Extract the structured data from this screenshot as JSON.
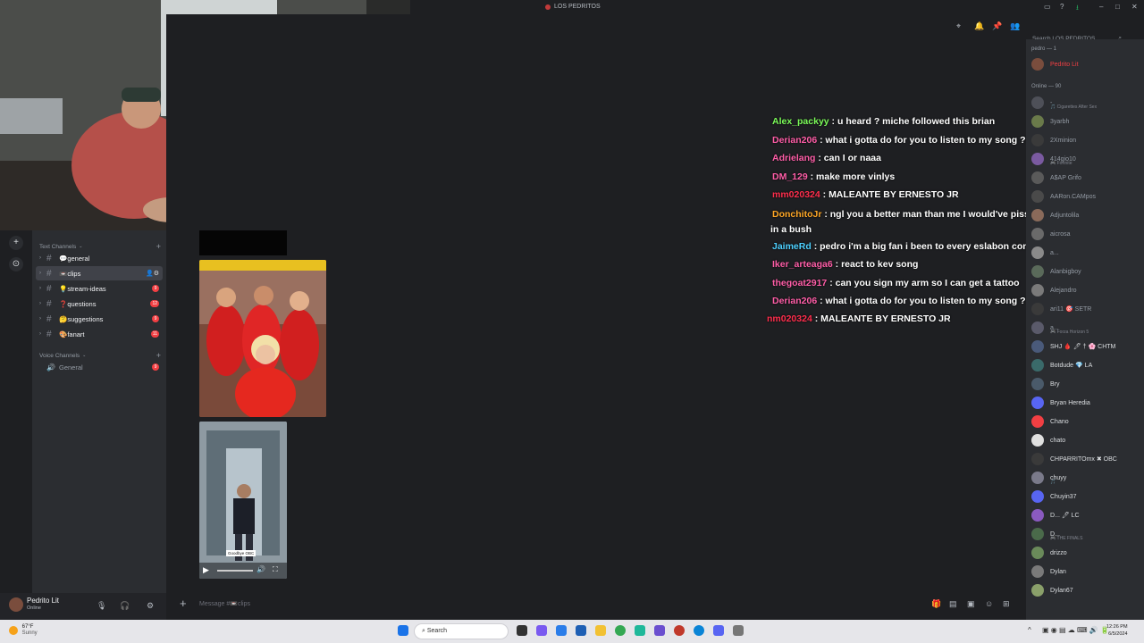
{
  "window": {
    "title": "LOS PEDRITOS"
  },
  "header": {
    "search_placeholder": "Search LOS PEDRITOS"
  },
  "sidebar": {
    "text_channels_label": "Text Channels",
    "voice_channels_label": "Voice Channels",
    "channels": [
      {
        "label": "💬general",
        "badge": ""
      },
      {
        "label": "📼clips",
        "badge": ""
      },
      {
        "label": "💡stream-ideas",
        "badge": "9"
      },
      {
        "label": "❓questions",
        "badge": "12"
      },
      {
        "label": "🤔suggestions",
        "badge": "9"
      },
      {
        "label": "🎨fanart",
        "badge": "11"
      }
    ],
    "voice": [
      {
        "label": "General",
        "badge": "9"
      }
    ]
  },
  "user_panel": {
    "name": "Pedrito Lit",
    "status": "Online"
  },
  "composer": {
    "placeholder": "Message #📼clips"
  },
  "video": {
    "caption": "Goodbye OBC"
  },
  "chat": [
    {
      "user": "Alex_packyy",
      "color": "#7cfc5a",
      "text": "u heard ? miche followed this brian"
    },
    {
      "user": "Derian206",
      "color": "#ff5ea8",
      "text": "what i gotta do for you to listen to my song ??"
    },
    {
      "user": "Adrielang",
      "color": "#ff5ea8",
      "text": "can I or naaa"
    },
    {
      "user": "DM_129",
      "color": "#ff5ea8",
      "text": "make more vinlys"
    },
    {
      "user": "mm020324",
      "color": "#ff2e4d",
      "text": "MALEANTE BY ERNESTO JR"
    },
    {
      "user": "DonchitoJr",
      "color": "#ffa726",
      "text": "ngl you a better man than me I would've pissed outside of his house in a bush"
    },
    {
      "user": "JaimeRd",
      "color": "#4dd0ff",
      "text": "pedro i'm a big fan i been to every eslabon concert in nebraska"
    },
    {
      "user": "Iker_arteaga6",
      "color": "#ff5ea8",
      "text": "react to kev song"
    },
    {
      "user": "thegoat2917",
      "color": "#ff5ea8",
      "text": "can you sign my arm so I can get a tattoo"
    },
    {
      "user": "Derian206",
      "color": "#ff5ea8",
      "text": "what i gotta do for you to listen to my song ??"
    },
    {
      "user": "nm020324",
      "color": "#ff2e4d",
      "text": "MALEANTE BY ERNESTO JR"
    }
  ],
  "members": {
    "group1_label": "pedro — 1",
    "online_label": "Online — 90",
    "list": [
      {
        "name": "Pedrito Lit",
        "sub": "",
        "color": "#f23f43",
        "av": "#7a4d3d"
      },
      {
        "name": "-",
        "sub": "🎵 Cigarettes After Sex",
        "color": "#949ba4",
        "av": "#4e5058"
      },
      {
        "name": "3yarbh",
        "sub": "",
        "color": "#949ba4",
        "av": "#6a7a4a"
      },
      {
        "name": "2Xminion",
        "sub": "",
        "color": "#949ba4",
        "av": "#3a3a3a"
      },
      {
        "name": "414gio10",
        "sub": "🎮 Fortnite",
        "color": "#949ba4",
        "av": "#7a5aa0"
      },
      {
        "name": "A$AP Grifo",
        "sub": "",
        "color": "#949ba4",
        "av": "#5a5a5a"
      },
      {
        "name": "AARon.CAMpos",
        "sub": "",
        "color": "#949ba4",
        "av": "#4a4a4a"
      },
      {
        "name": "Adjuntolila",
        "sub": "",
        "color": "#949ba4",
        "av": "#8a6a5a"
      },
      {
        "name": "aicrosa",
        "sub": "",
        "color": "#949ba4",
        "av": "#6a6a6a"
      },
      {
        "name": "a...",
        "sub": "",
        "color": "#949ba4",
        "av": "#8a8a8a"
      },
      {
        "name": "Alanbigboy",
        "sub": "",
        "color": "#949ba4",
        "av": "#5a6a5a"
      },
      {
        "name": "Alejandro",
        "sub": "",
        "color": "#949ba4",
        "av": "#7a7a7a"
      },
      {
        "name": "ari11 🎯 SETR",
        "sub": "",
        "color": "#949ba4",
        "av": "#3a3a3a"
      },
      {
        "name": "a...",
        "sub": "🎮 Forza Horizon 5",
        "color": "#949ba4",
        "av": "#5a5a6a"
      },
      {
        "name": "SHJ 🩸 🖊 † 🌸 CHTM",
        "sub": "",
        "color": "#dbdee1",
        "av": "#4a5a7a"
      },
      {
        "name": "Botdude 💎 LA",
        "sub": "",
        "color": "#dbdee1",
        "av": "#3a6a6a"
      },
      {
        "name": "Bry",
        "sub": "",
        "color": "#dbdee1",
        "av": "#4a5a6a"
      },
      {
        "name": "Bryan Heredia",
        "sub": "",
        "color": "#dbdee1",
        "av": "#5865f2"
      },
      {
        "name": "Chano",
        "sub": "",
        "color": "#dbdee1",
        "av": "#f23f43"
      },
      {
        "name": "chato",
        "sub": "",
        "color": "#dbdee1",
        "av": "#e0e0e0"
      },
      {
        "name": "CHPARRITOmx ✖ OBC",
        "sub": "",
        "color": "#dbdee1",
        "av": "#3a3a3a"
      },
      {
        "name": "chuyy",
        "sub": "🎵",
        "color": "#dbdee1",
        "av": "#7a7a8a"
      },
      {
        "name": "Chuyin37",
        "sub": "",
        "color": "#dbdee1",
        "av": "#5865f2"
      },
      {
        "name": "D... 🖊 LC",
        "sub": "",
        "color": "#dbdee1",
        "av": "#8a5ac0"
      },
      {
        "name": "D...",
        "sub": "🎮 THE FINALS",
        "color": "#dbdee1",
        "av": "#4a6a4a"
      },
      {
        "name": "drizzo",
        "sub": "",
        "color": "#dbdee1",
        "av": "#6a8a5a"
      },
      {
        "name": "Dylan",
        "sub": "",
        "color": "#dbdee1",
        "av": "#7a7a7a"
      },
      {
        "name": "Dylan67",
        "sub": "",
        "color": "#dbdee1",
        "av": "#8aa06a"
      }
    ]
  },
  "taskbar": {
    "weather_temp": "67°F",
    "weather_text": "Sunny",
    "search_label": "Search",
    "time": "12:26 PM",
    "date": "6/5/2024"
  }
}
